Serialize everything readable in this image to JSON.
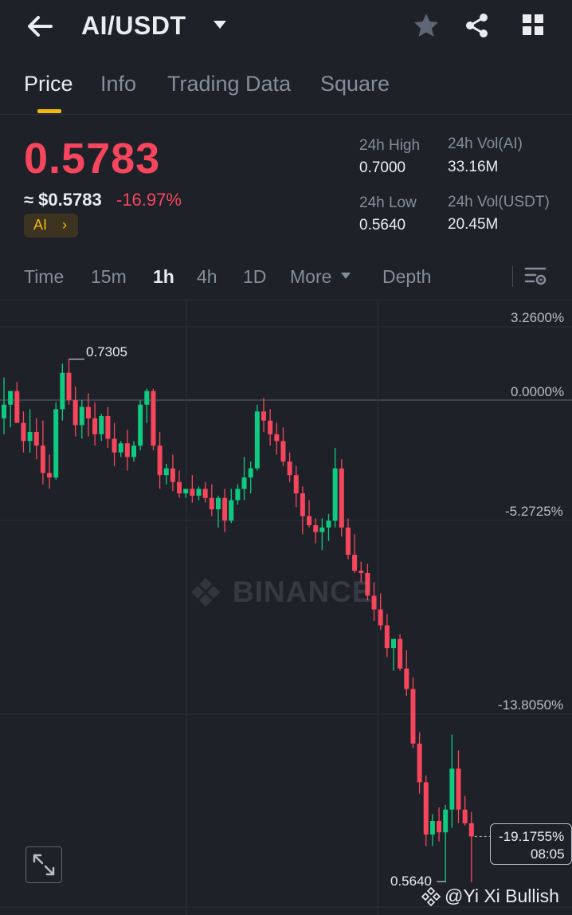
{
  "header": {
    "pair": "AI/USDT",
    "icons": [
      "back-arrow-icon",
      "caret-down-icon",
      "star-icon",
      "share-icon",
      "grid-icon"
    ]
  },
  "tabs": [
    {
      "label": "Price",
      "active": true
    },
    {
      "label": "Info",
      "active": false
    },
    {
      "label": "Trading Data",
      "active": false
    },
    {
      "label": "Square",
      "active": false
    }
  ],
  "ticker": {
    "price": "0.5783",
    "usd_price": "≈ $0.5783",
    "change": "-16.97%",
    "tag": "AI",
    "tag_chevron": "›",
    "high_label": "24h High",
    "high_value": "0.7000",
    "low_label": "24h Low",
    "low_value": "0.5640",
    "vol_ai_label": "24h Vol(AI)",
    "vol_ai_value": "33.16M",
    "vol_usdt_label": "24h Vol(USDT)",
    "vol_usdt_value": "20.45M"
  },
  "intervals": [
    {
      "label": "Time",
      "active": false
    },
    {
      "label": "15m",
      "active": false
    },
    {
      "label": "1h",
      "active": true
    },
    {
      "label": "4h",
      "active": false
    },
    {
      "label": "1D",
      "active": false
    },
    {
      "label": "More",
      "active": false
    },
    {
      "label": "Depth",
      "active": false
    }
  ],
  "colors": {
    "up": "#0ecb81",
    "down": "#f6465d",
    "accent": "#f0b90b",
    "background": "#1f2129"
  },
  "chart_data": {
    "type": "candlestick",
    "y_axis_labels": [
      "3.2600%",
      "0.0000%",
      "-5.2725%",
      "-13.8050%"
    ],
    "y_unit": "percent change",
    "high_marker": "0.7305",
    "low_marker": "0.5640",
    "current_pct": "-19.1755%",
    "countdown": "08:05",
    "watermark": "BINANCE",
    "candles": [
      {
        "o": -0.8,
        "h": 1.0,
        "l": -1.5,
        "c": -0.2
      },
      {
        "o": -0.2,
        "h": 0.3,
        "l": -1.2,
        "c": 0.4
      },
      {
        "o": 0.4,
        "h": 0.8,
        "l": -1.0,
        "c": -1.0
      },
      {
        "o": -1.0,
        "h": -0.5,
        "l": -2.3,
        "c": -1.8
      },
      {
        "o": -1.8,
        "h": -0.4,
        "l": -2.3,
        "c": -1.4
      },
      {
        "o": -1.4,
        "h": -0.8,
        "l": -2.6,
        "c": -2.0
      },
      {
        "o": -2.0,
        "h": -0.9,
        "l": -3.7,
        "c": -3.2
      },
      {
        "o": -3.2,
        "h": -2.4,
        "l": -3.9,
        "c": -3.4
      },
      {
        "o": -3.4,
        "h": -0.1,
        "l": -3.5,
        "c": -0.4
      },
      {
        "o": -0.4,
        "h": 1.6,
        "l": -0.9,
        "c": 1.2
      },
      {
        "o": 1.2,
        "h": 1.8,
        "l": -0.2,
        "c": 0.0
      },
      {
        "o": 0.0,
        "h": 0.6,
        "l": -1.6,
        "c": -1.1
      },
      {
        "o": -1.1,
        "h": 0.0,
        "l": -1.7,
        "c": -0.3
      },
      {
        "o": -0.3,
        "h": 0.3,
        "l": -1.6,
        "c": -0.8
      },
      {
        "o": -0.8,
        "h": -0.1,
        "l": -2.0,
        "c": -1.5
      },
      {
        "o": -1.5,
        "h": -0.6,
        "l": -1.8,
        "c": -0.7
      },
      {
        "o": -0.7,
        "h": -0.3,
        "l": -2.1,
        "c": -1.7
      },
      {
        "o": -1.7,
        "h": -1.0,
        "l": -2.9,
        "c": -2.3
      },
      {
        "o": -2.3,
        "h": -1.8,
        "l": -2.5,
        "c": -1.9
      },
      {
        "o": -1.9,
        "h": -1.3,
        "l": -3.1,
        "c": -2.5
      },
      {
        "o": -2.5,
        "h": -1.8,
        "l": -2.7,
        "c": -2.0
      },
      {
        "o": -2.0,
        "h": 0.0,
        "l": -2.2,
        "c": -0.2
      },
      {
        "o": -0.2,
        "h": 0.5,
        "l": -1.0,
        "c": 0.4
      },
      {
        "o": 0.4,
        "h": 0.5,
        "l": -2.2,
        "c": -2.0
      },
      {
        "o": -2.0,
        "h": -1.4,
        "l": -3.9,
        "c": -3.3
      },
      {
        "o": -3.3,
        "h": -2.8,
        "l": -3.7,
        "c": -3.0
      },
      {
        "o": -3.0,
        "h": -2.4,
        "l": -4.0,
        "c": -3.6
      },
      {
        "o": -3.6,
        "h": -3.1,
        "l": -4.3,
        "c": -4.1
      },
      {
        "o": -4.1,
        "h": -3.9,
        "l": -4.3,
        "c": -3.9
      },
      {
        "o": -3.9,
        "h": -3.3,
        "l": -4.5,
        "c": -4.2
      },
      {
        "o": -4.2,
        "h": -3.8,
        "l": -4.4,
        "c": -3.9
      },
      {
        "o": -3.9,
        "h": -3.6,
        "l": -4.5,
        "c": -4.3
      },
      {
        "o": -4.3,
        "h": -3.7,
        "l": -5.1,
        "c": -4.8
      },
      {
        "o": -4.8,
        "h": -4.2,
        "l": -5.6,
        "c": -4.3
      },
      {
        "o": -4.3,
        "h": -3.9,
        "l": -5.8,
        "c": -5.3
      },
      {
        "o": -5.3,
        "h": -3.9,
        "l": -5.4,
        "c": -4.4
      },
      {
        "o": -4.4,
        "h": -3.7,
        "l": -4.6,
        "c": -3.9
      },
      {
        "o": -3.9,
        "h": -2.5,
        "l": -4.4,
        "c": -3.4
      },
      {
        "o": -3.4,
        "h": -2.7,
        "l": -4.1,
        "c": -3.0
      },
      {
        "o": -3.0,
        "h": -0.2,
        "l": -3.1,
        "c": -0.5
      },
      {
        "o": -0.5,
        "h": 0.1,
        "l": -1.4,
        "c": -0.9
      },
      {
        "o": -0.9,
        "h": -0.4,
        "l": -2.0,
        "c": -1.5
      },
      {
        "o": -1.5,
        "h": -1.0,
        "l": -2.4,
        "c": -1.8
      },
      {
        "o": -1.8,
        "h": -1.2,
        "l": -2.9,
        "c": -2.7
      },
      {
        "o": -2.7,
        "h": -2.3,
        "l": -3.6,
        "c": -3.3
      },
      {
        "o": -3.3,
        "h": -2.9,
        "l": -4.7,
        "c": -4.1
      },
      {
        "o": -4.1,
        "h": -3.8,
        "l": -5.9,
        "c": -5.1
      },
      {
        "o": -5.1,
        "h": -4.4,
        "l": -5.6,
        "c": -5.5
      },
      {
        "o": -5.5,
        "h": -5.2,
        "l": -6.3,
        "c": -5.8
      },
      {
        "o": -5.8,
        "h": -5.2,
        "l": -6.6,
        "c": -5.6
      },
      {
        "o": -5.6,
        "h": -5.0,
        "l": -6.2,
        "c": -5.3
      },
      {
        "o": -5.3,
        "h": -2.1,
        "l": -5.6,
        "c": -3.0
      },
      {
        "o": -3.0,
        "h": -2.6,
        "l": -6.0,
        "c": -5.6
      },
      {
        "o": -5.6,
        "h": -5.2,
        "l": -7.0,
        "c": -6.8
      },
      {
        "o": -6.8,
        "h": -5.9,
        "l": -7.6,
        "c": -7.5
      },
      {
        "o": -7.5,
        "h": -7.1,
        "l": -8.0,
        "c": -7.6
      },
      {
        "o": -7.6,
        "h": -7.2,
        "l": -8.8,
        "c": -8.6
      },
      {
        "o": -8.6,
        "h": -8.0,
        "l": -9.7,
        "c": -9.2
      },
      {
        "o": -9.2,
        "h": -8.5,
        "l": -10.1,
        "c": -9.9
      },
      {
        "o": -9.9,
        "h": -9.4,
        "l": -11.3,
        "c": -10.9
      },
      {
        "o": -10.9,
        "h": -10.5,
        "l": -11.9,
        "c": -10.5
      },
      {
        "o": -10.5,
        "h": -10.3,
        "l": -11.9,
        "c": -11.8
      },
      {
        "o": -11.8,
        "h": -11.0,
        "l": -13.0,
        "c": -12.7
      },
      {
        "o": -12.7,
        "h": -12.2,
        "l": -15.3,
        "c": -15.1
      },
      {
        "o": -15.1,
        "h": -14.6,
        "l": -17.3,
        "c": -16.8
      },
      {
        "o": -16.8,
        "h": -16.5,
        "l": -19.6,
        "c": -19.1
      },
      {
        "o": -19.1,
        "h": -18.2,
        "l": -19.6,
        "c": -18.5
      },
      {
        "o": -18.5,
        "h": -17.9,
        "l": -19.4,
        "c": -19.0
      },
      {
        "o": -19.0,
        "h": -17.8,
        "l": -21.2,
        "c": -18.0
      },
      {
        "o": -18.0,
        "h": -14.7,
        "l": -18.8,
        "c": -16.2
      },
      {
        "o": -16.2,
        "h": -15.4,
        "l": -18.6,
        "c": -18.0
      },
      {
        "o": -18.0,
        "h": -17.4,
        "l": -18.7,
        "c": -18.6
      },
      {
        "o": -18.6,
        "h": -18.1,
        "l": -21.2,
        "c": -19.18
      }
    ]
  },
  "credit": "@Yi Xi Bullish"
}
